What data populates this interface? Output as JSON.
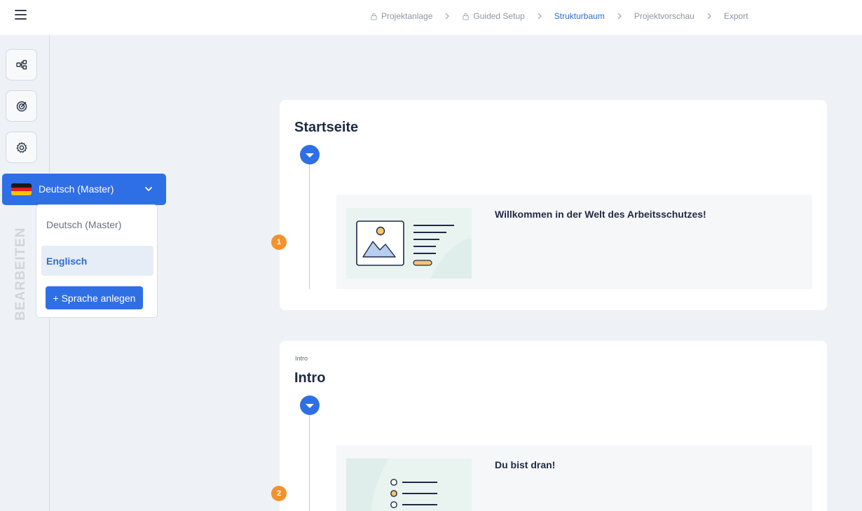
{
  "breadcrumb": [
    {
      "label": "Projektanlage",
      "locked": true
    },
    {
      "label": "Guided Setup",
      "locked": true
    },
    {
      "label": "Strukturbaum",
      "locked": false,
      "active": true
    },
    {
      "label": "Projektvorschau",
      "locked": false
    },
    {
      "label": "Export",
      "locked": false
    }
  ],
  "sidebar": {
    "vertical_label": "BEARBEITEN"
  },
  "language": {
    "selected": "Deutsch (Master)",
    "options": [
      "Deutsch (Master)",
      "Englisch"
    ],
    "highlighted": "Englisch",
    "add_label": "+ Sprache anlegen"
  },
  "cards": [
    {
      "small_label": "",
      "title": "Startseite",
      "index": "1",
      "element_title": "Willkommen in der Welt des Arbeitsschutzes!"
    },
    {
      "small_label": "Intro",
      "title": "Intro",
      "index": "2",
      "element_title": "Du bist dran!"
    }
  ],
  "colors": {
    "accent": "#2f6fe6",
    "badge": "#f3922d",
    "background": "#eef2f6"
  }
}
